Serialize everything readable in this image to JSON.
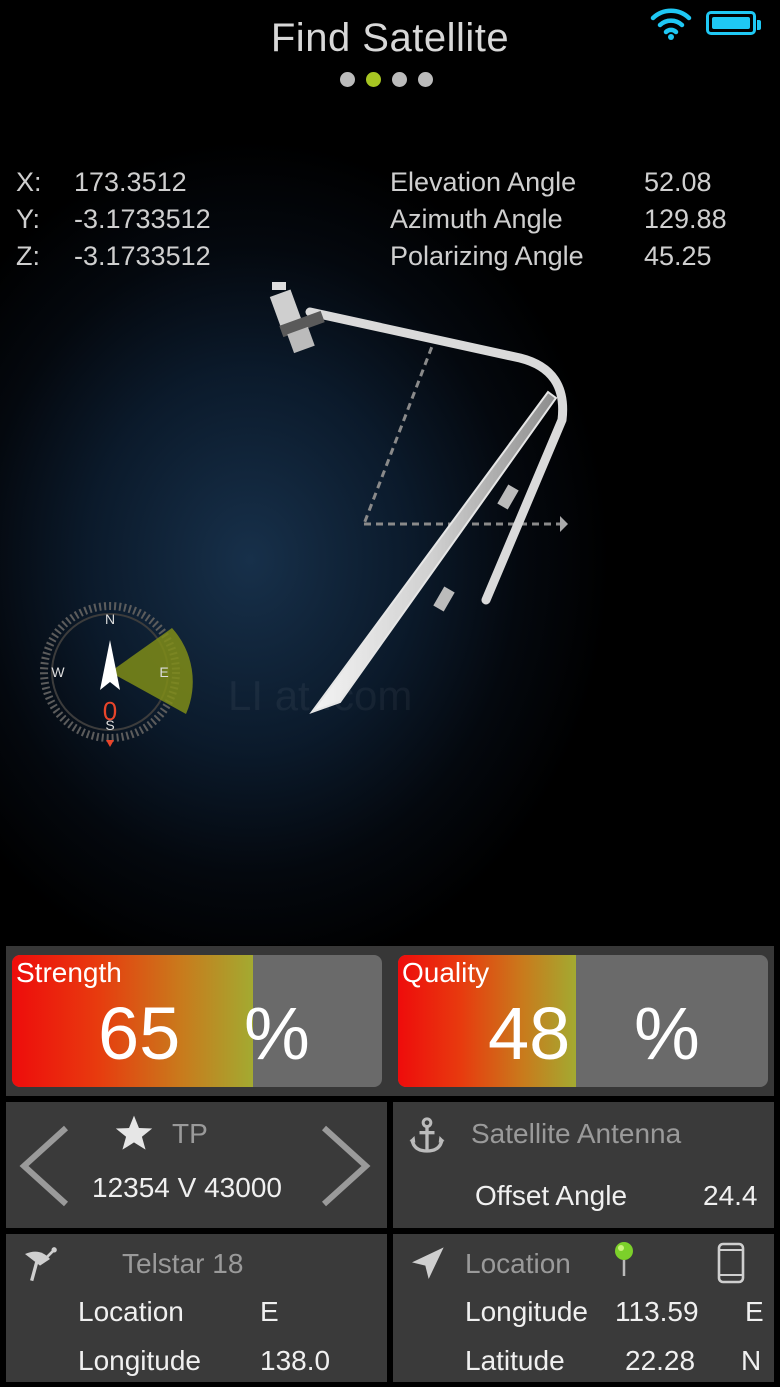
{
  "header": {
    "title": "Find Satellite",
    "pages": [
      false,
      true,
      false,
      false
    ]
  },
  "readouts": {
    "xyz": [
      {
        "label": "X:",
        "value": "173.3512"
      },
      {
        "label": "Y:",
        "value": "-3.1733512"
      },
      {
        "label": "Z:",
        "value": "-3.1733512"
      }
    ],
    "angles": [
      {
        "label": "Elevation Angle",
        "value": "52.08"
      },
      {
        "label": "Azimuth Angle",
        "value": "129.88"
      },
      {
        "label": "Polarizing Angle",
        "value": "45.25"
      }
    ]
  },
  "compass": {
    "n": "N",
    "s": "S",
    "e": "E",
    "w": "W",
    "value": "0"
  },
  "watermark": "LI     at    .com",
  "meters": {
    "strength": {
      "label": "Strength",
      "value": "65",
      "unit": "%",
      "level": 0.65
    },
    "quality": {
      "label": "Quality",
      "value": "48",
      "unit": "%",
      "level": 0.48
    }
  },
  "tp": {
    "label": "TP",
    "value": "12354 V 43000"
  },
  "antenna": {
    "title": "Satellite Antenna",
    "offset_label": "Offset Angle",
    "offset_value": "24.4"
  },
  "satellite": {
    "name": "Telstar 18",
    "location_label": "Location",
    "location_value": "E",
    "longitude_label": "Longitude",
    "longitude_value": "138.0"
  },
  "location": {
    "title": "Location",
    "longitude_label": "Longitude",
    "longitude_value": "113.59",
    "longitude_dir": "E",
    "latitude_label": "Latitude",
    "latitude_value": "22.28",
    "latitude_dir": "N"
  },
  "colors": {
    "accent_green": "#a7c522",
    "battery_blue": "#1fc8f4",
    "needle_red": "#e8452a"
  }
}
